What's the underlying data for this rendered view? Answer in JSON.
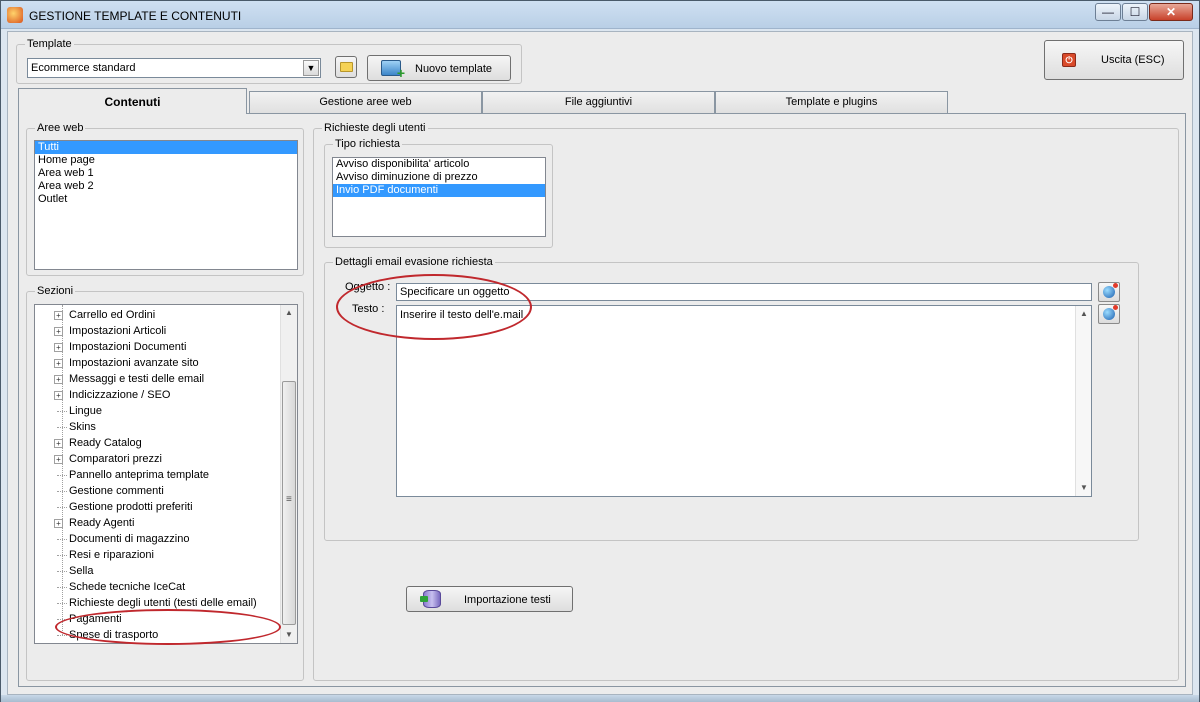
{
  "window": {
    "title": "GESTIONE TEMPLATE E CONTENUTI",
    "minimize_glyph": "—",
    "maximize_glyph": "☐",
    "close_glyph": "✕"
  },
  "template_group": {
    "label": "Template",
    "selected": "Ecommerce standard",
    "combo_arrow": "▼",
    "new_button": "Nuovo template"
  },
  "exit_button": {
    "label": "Uscita (ESC)",
    "icon_glyph": "⏻"
  },
  "tabs": [
    {
      "label": "Contenuti",
      "active": true
    },
    {
      "label": "Gestione aree web",
      "active": false
    },
    {
      "label": "File aggiuntivi",
      "active": false
    },
    {
      "label": "Template e plugins",
      "active": false
    }
  ],
  "aree_web": {
    "label": "Aree web",
    "items": [
      "Tutti",
      "Home page",
      "Area web 1",
      "Area web 2",
      "Outlet"
    ],
    "selected_index": 0
  },
  "sezioni": {
    "label": "Sezioni",
    "items": [
      {
        "label": "Carrello ed Ordini",
        "expandable": true
      },
      {
        "label": "Impostazioni Articoli",
        "expandable": true
      },
      {
        "label": "Impostazioni Documenti",
        "expandable": true
      },
      {
        "label": "Impostazioni avanzate sito",
        "expandable": true
      },
      {
        "label": "Messaggi e testi delle email",
        "expandable": true
      },
      {
        "label": "Indicizzazione / SEO",
        "expandable": true
      },
      {
        "label": "Lingue",
        "expandable": false
      },
      {
        "label": "Skins",
        "expandable": false
      },
      {
        "label": "Ready Catalog",
        "expandable": true
      },
      {
        "label": "Comparatori prezzi",
        "expandable": true
      },
      {
        "label": "Pannello anteprima template",
        "expandable": false
      },
      {
        "label": "Gestione commenti",
        "expandable": false
      },
      {
        "label": "Gestione prodotti preferiti",
        "expandable": false
      },
      {
        "label": "Ready Agenti",
        "expandable": true
      },
      {
        "label": "Documenti di magazzino",
        "expandable": false
      },
      {
        "label": "Resi e riparazioni",
        "expandable": false
      },
      {
        "label": "Sella",
        "expandable": false
      },
      {
        "label": "Schede tecniche IceCat",
        "expandable": false
      },
      {
        "label": "Richieste degli utenti (testi delle email)",
        "expandable": false
      },
      {
        "label": "Pagamenti",
        "expandable": false
      },
      {
        "label": "Spese di trasporto",
        "expandable": false
      }
    ],
    "expand_glyph": "+",
    "scroll_up": "▲",
    "scroll_down": "▼",
    "thumb_grip": "≡"
  },
  "richieste": {
    "label": "Richieste degli utenti",
    "tipo_label": "Tipo richiesta",
    "tipo_items": [
      "Avviso disponibilita' articolo",
      "Avviso diminuzione di prezzo",
      "Invio PDF documenti"
    ],
    "tipo_selected_index": 2,
    "dettagli_label": "Dettagli email evasione richiesta",
    "oggetto_label": "Oggetto :",
    "oggetto_value": "Specificare un oggetto",
    "testo_label": "Testo :",
    "testo_value": "Inserire il testo dell'e.mail",
    "import_button": "Importazione testi",
    "scroll_up": "▲",
    "scroll_down": "▼"
  },
  "colors": {
    "selection": "#3399ff",
    "highlight_ring": "#c0282d"
  }
}
